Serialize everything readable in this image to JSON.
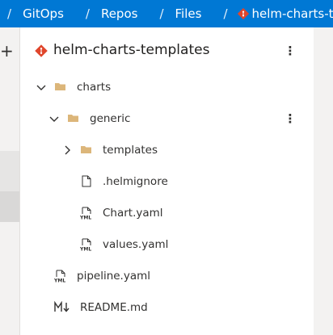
{
  "breadcrumb": {
    "items": [
      "GitOps",
      "Repos",
      "Files",
      "helm-charts-templates"
    ],
    "separator": "/"
  },
  "left_strip": {
    "add_symbol": "+"
  },
  "panel": {
    "repo_name": "helm-charts-templates",
    "more_symbol": "⋮"
  },
  "tree": [
    {
      "label": "charts",
      "type": "folder",
      "expanded": true,
      "depth": 0
    },
    {
      "label": "generic",
      "type": "folder",
      "expanded": true,
      "depth": 1
    },
    {
      "label": "templates",
      "type": "folder",
      "expanded": false,
      "depth": 2
    },
    {
      "label": ".helmignore",
      "type": "file",
      "depth": 2
    },
    {
      "label": "Chart.yaml",
      "type": "yaml",
      "depth": 2
    },
    {
      "label": "values.yaml",
      "type": "yaml",
      "depth": 2
    },
    {
      "label": "pipeline.yaml",
      "type": "yaml",
      "depth": 0
    },
    {
      "label": "README.md",
      "type": "markdown",
      "depth": 0
    }
  ],
  "colors": {
    "accent": "#0078d4",
    "folder": "#dcb67a",
    "repo_icon": "#e0462c"
  }
}
